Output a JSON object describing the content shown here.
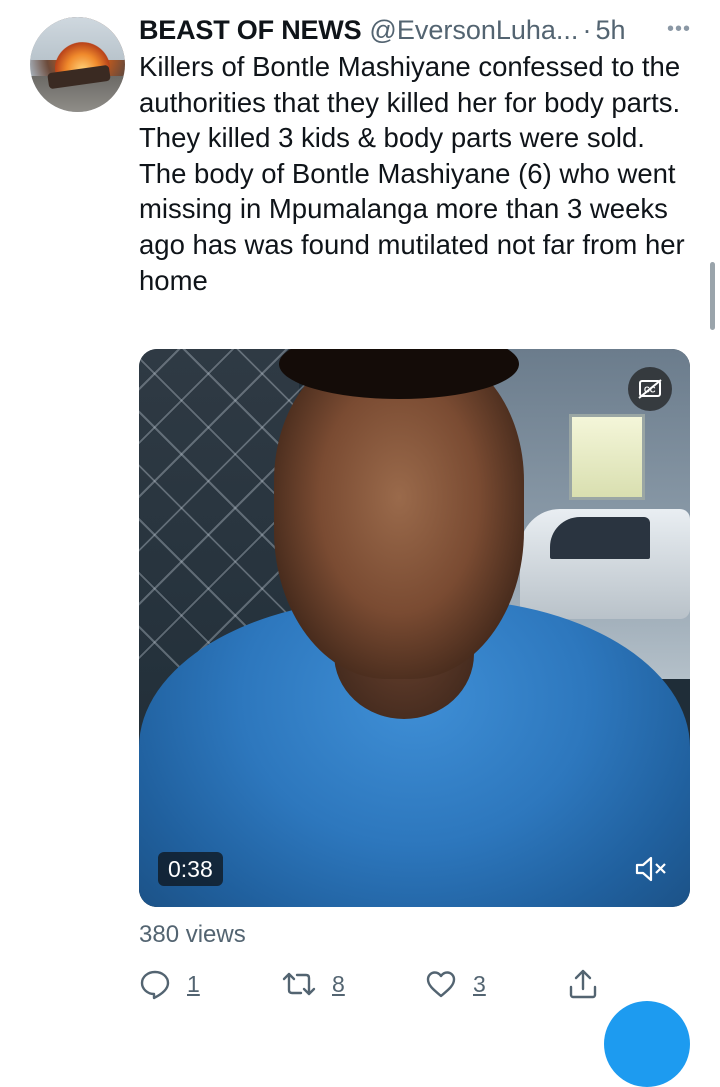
{
  "tweet": {
    "author_name": "BEAST OF NEWS",
    "author_handle": "@EversonLuha...",
    "separator": "·",
    "time_ago": "5h",
    "more_label": "•••",
    "text": "Killers of Bontle Mashiyane confessed to the authorities that they killed her for body parts. They killed 3 kids & body parts were sold. The body of Bontle Mashiyane (6) who went missing in Mpumalanga more than 3 weeks ago has was found mutilated not far from her home",
    "views": "380 views"
  },
  "video": {
    "duration": "0:38",
    "captions_icon": "closed-captions-icon",
    "mute_icon": "speaker-muted-icon"
  },
  "actions": {
    "reply_count": "1",
    "retweet_count": "8",
    "like_count": "3",
    "reply_icon": "reply-icon",
    "retweet_icon": "retweet-icon",
    "like_icon": "heart-icon",
    "share_icon": "share-icon"
  },
  "colors": {
    "text_primary": "#0f1419",
    "text_secondary": "#536471",
    "accent": "#1d9bf0"
  }
}
